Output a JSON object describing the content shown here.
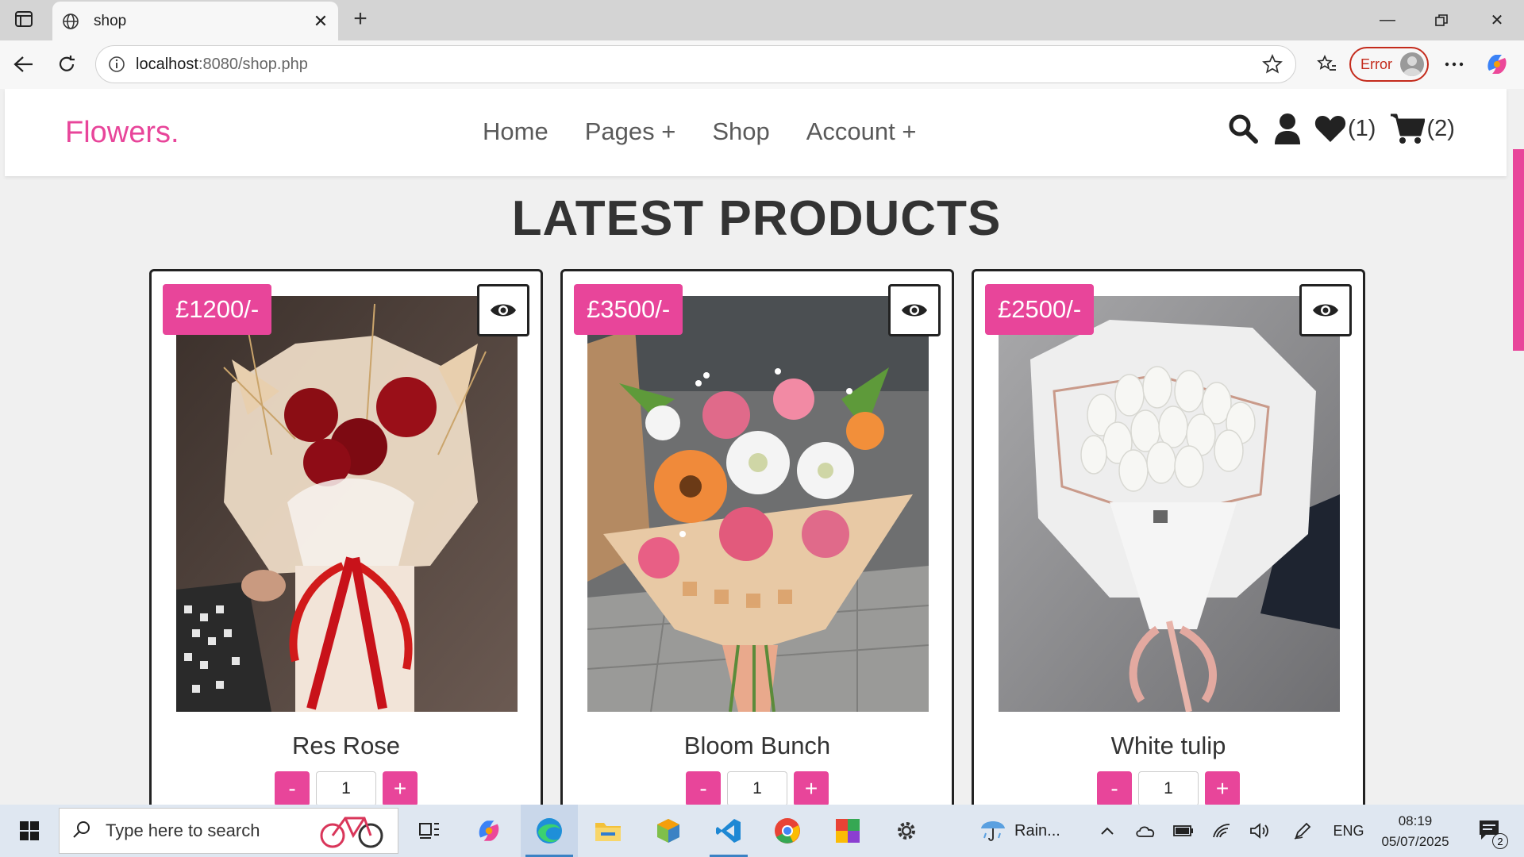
{
  "browser": {
    "tab_title": "shop",
    "url_host": "localhost",
    "url_rest": ":8080/shop.php",
    "profile_status": "Error"
  },
  "site": {
    "logo": "Flowers.",
    "nav": [
      "Home",
      "Pages +",
      "Shop",
      "Account +"
    ],
    "wishlist_count": "(1)",
    "cart_count": "(2)",
    "section_title": "LATEST PRODUCTS",
    "products": [
      {
        "price": "£1200/-",
        "name": "Res Rose",
        "quantity": "1",
        "image": "red-rose-bouquet"
      },
      {
        "price": "£3500/-",
        "name": "Bloom Bunch",
        "quantity": "1",
        "image": "mixed-bloom-bouquet"
      },
      {
        "price": "£2500/-",
        "name": "White tulip",
        "quantity": "1",
        "image": "white-tulip-bouquet"
      }
    ],
    "minus_label": "-",
    "plus_label": "+"
  },
  "taskbar": {
    "search_placeholder": "Type here to search",
    "weather": "Rain...",
    "language": "ENG",
    "time": "08:19",
    "date": "05/07/2025",
    "notification_count": "2"
  },
  "colors": {
    "accent": "#e8459a",
    "heading": "#333333"
  }
}
